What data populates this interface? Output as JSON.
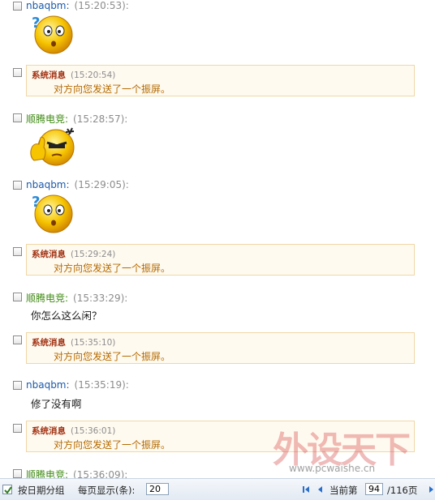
{
  "messages": [
    {
      "sender": "nbaqbm:",
      "time": "(15:20:53):"
    },
    {
      "sys_title": "系统消息",
      "time": "(15:20:54)",
      "text": "对方向您发送了一个振屏。"
    },
    {
      "sender": "顺腾电竞:",
      "time": "(15:28:57):"
    },
    {
      "sender": "nbaqbm:",
      "time": "(15:29:05):"
    },
    {
      "sys_title": "系统消息",
      "time": "(15:29:24)",
      "text": "对方向您发送了一个振屏。"
    },
    {
      "sender": "顺腾电竞:",
      "time": "(15:33:29):",
      "text": "你怎么这么闲？"
    },
    {
      "sys_title": "系统消息",
      "time": "(15:35:10)",
      "text": "对方向您发送了一个振屏。"
    },
    {
      "sender": "nbaqbm:",
      "time": "(15:35:19):",
      "text": "修了没有啊"
    },
    {
      "sys_title": "系统消息",
      "time": "(15:36:01)",
      "text": "对方向您发送了一个振屏。"
    },
    {
      "sender": "顺腾电竞:",
      "time": "(15:36:09):"
    }
  ],
  "footer": {
    "group_by_date": "按日期分组",
    "group_checked": true,
    "per_page_label": "每页显示(条):",
    "per_page_value": "20",
    "current_page_label": "当前第",
    "current_page": "94",
    "total_pages": "/116页"
  },
  "watermark": {
    "text": "外设天下",
    "url": "www.pcwaishe.cn"
  },
  "colors": {
    "sender_blue": "#1b59a8",
    "sender_green": "#3e8a12",
    "system_title": "#a03010",
    "system_text": "#b36a00"
  }
}
